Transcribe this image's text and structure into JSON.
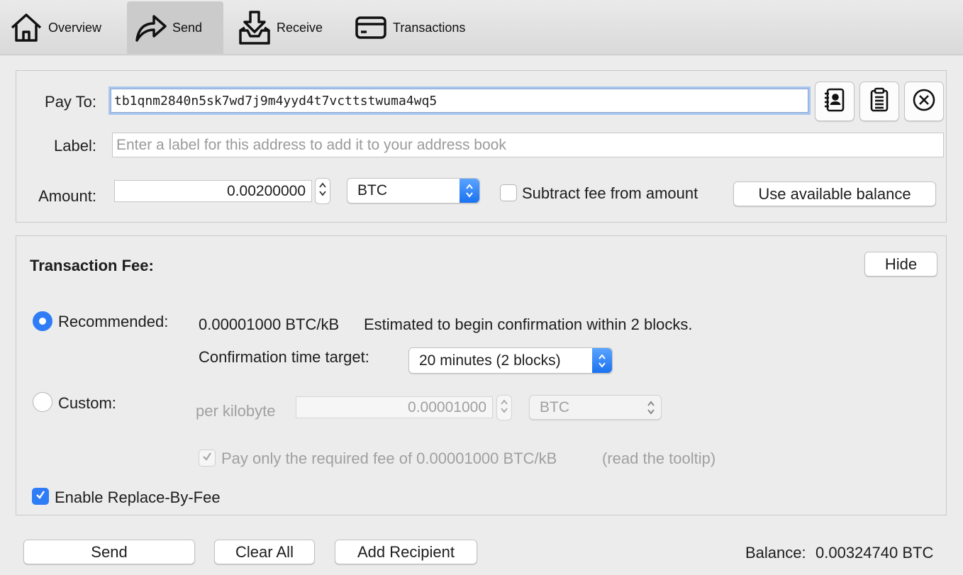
{
  "toolbar": {
    "tabs": [
      {
        "label": "Overview",
        "icon": "home-icon"
      },
      {
        "label": "Send",
        "icon": "send-arrow-icon",
        "active": true
      },
      {
        "label": "Receive",
        "icon": "receive-tray-icon"
      },
      {
        "label": "Transactions",
        "icon": "card-icon"
      }
    ]
  },
  "recipient": {
    "pay_to_label": "Pay To:",
    "pay_to_value": "tb1qnm2840n5sk7wd7j9m4yyd4t7vcttstwuma4wq5",
    "label_label": "Label:",
    "label_placeholder": "Enter a label for this address to add it to your address book",
    "amount_label": "Amount:",
    "amount_value": "0.00200000",
    "unit": "BTC",
    "subtract_fee_label": "Subtract fee from amount",
    "subtract_fee_checked": false,
    "use_balance_label": "Use available balance",
    "buttons": [
      "address-book-icon",
      "paste-icon",
      "remove-circle-icon"
    ]
  },
  "fee": {
    "title": "Transaction Fee:",
    "hide_label": "Hide",
    "recommended_label": "Recommended:",
    "recommended_rate": "0.00001000 BTC/kB",
    "recommended_estimate": "Estimated to begin confirmation within 2 blocks.",
    "conf_target_label": "Confirmation time target:",
    "conf_target_value": "20 minutes (2 blocks)",
    "custom_label": "Custom:",
    "per_kilobyte_label": "per kilobyte",
    "custom_value": "0.00001000",
    "custom_unit": "BTC",
    "pay_required_label": "Pay only the required fee of 0.00001000 BTC/kB",
    "pay_required_hint": "(read the tooltip)",
    "rbf_label": "Enable Replace-By-Fee",
    "rbf_checked": true,
    "selected": "recommended"
  },
  "footer": {
    "send_label": "Send",
    "clear_label": "Clear All",
    "add_recipient_label": "Add Recipient",
    "balance_label": "Balance:",
    "balance_value": "0.00324740 BTC"
  },
  "colors": {
    "accent": "#2f7df6",
    "background": "#ececec",
    "focus_ring": "#a9c6ee"
  }
}
